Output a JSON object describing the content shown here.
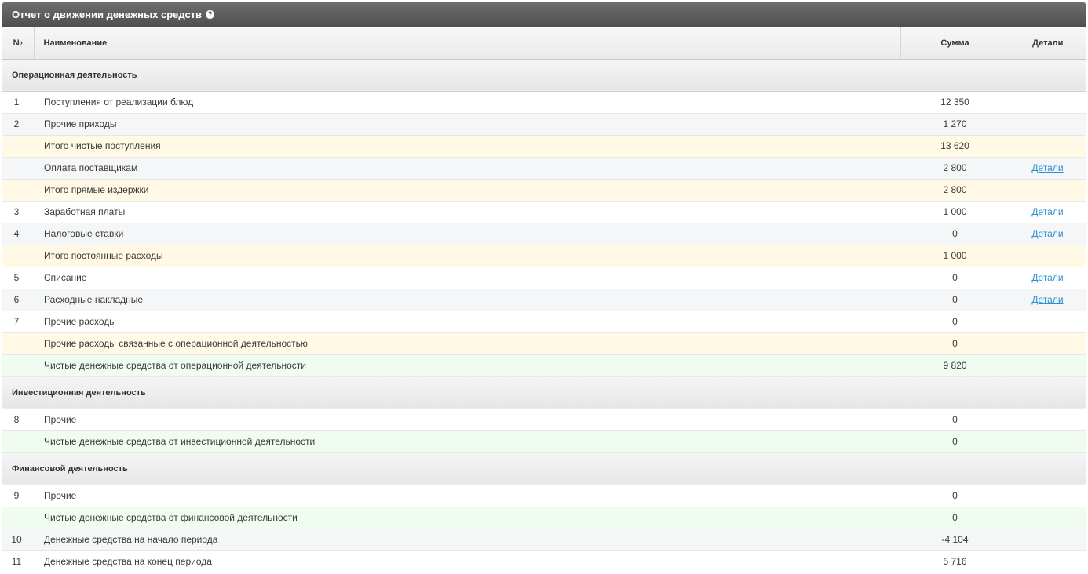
{
  "header": {
    "title": "Отчет о движении денежных средств",
    "help_glyph": "?"
  },
  "columns": {
    "num": "№",
    "name": "Наименование",
    "sum": "Сумма",
    "details": "Детали"
  },
  "sections": {
    "operational": "Операционная деятельность",
    "investment": "Инвестиционная деятельность",
    "financial": "Финансовой деятельность"
  },
  "rows": [
    {
      "num": "1",
      "name": "Поступления от реализации блюд",
      "sum": "12 350",
      "details": ""
    },
    {
      "num": "2",
      "name": "Прочие приходы",
      "sum": "1 270",
      "details": ""
    },
    {
      "num": "",
      "name": "Итого чистые поступления",
      "sum": "13 620",
      "details": ""
    },
    {
      "num": "",
      "name": "Оплата поставщикам",
      "sum": "2 800",
      "details": "Детали"
    },
    {
      "num": "",
      "name": "Итого прямые издержки",
      "sum": "2 800",
      "details": ""
    },
    {
      "num": "3",
      "name": "Заработная платы",
      "sum": "1 000",
      "details": "Детали"
    },
    {
      "num": "4",
      "name": "Налоговые ставки",
      "sum": "0",
      "details": "Детали"
    },
    {
      "num": "",
      "name": "Итого постоянные расходы",
      "sum": "1 000",
      "details": ""
    },
    {
      "num": "5",
      "name": "Списание",
      "sum": "0",
      "details": "Детали"
    },
    {
      "num": "6",
      "name": "Расходные накладные",
      "sum": "0",
      "details": "Детали"
    },
    {
      "num": "7",
      "name": "Прочие расходы",
      "sum": "0",
      "details": ""
    },
    {
      "num": "",
      "name": "Прочие расходы связанные с операционной деятельностью",
      "sum": "0",
      "details": ""
    },
    {
      "num": "",
      "name": "Чистые денежные средства от операционной деятельности",
      "sum": "9 820",
      "details": ""
    },
    {
      "num": "8",
      "name": "Прочие",
      "sum": "0",
      "details": ""
    },
    {
      "num": "",
      "name": "Чистые денежные средства от инвестиционной деятельности",
      "sum": "0",
      "details": ""
    },
    {
      "num": "9",
      "name": "Прочие",
      "sum": "0",
      "details": ""
    },
    {
      "num": "",
      "name": "Чистые денежные средства от финансовой деятельности",
      "sum": "0",
      "details": ""
    },
    {
      "num": "10",
      "name": "Денежные средства на начало периода",
      "sum": "-4 104",
      "details": ""
    },
    {
      "num": "11",
      "name": "Денежные средства на конец периода",
      "sum": "5 716",
      "details": ""
    }
  ],
  "colors": {
    "header_bg": "#5a5a5a",
    "subtotal_row": "#fff9e6",
    "net_row": "#f0fcef",
    "even_row": "#f5f6f7",
    "link": "#2a8fd1"
  }
}
